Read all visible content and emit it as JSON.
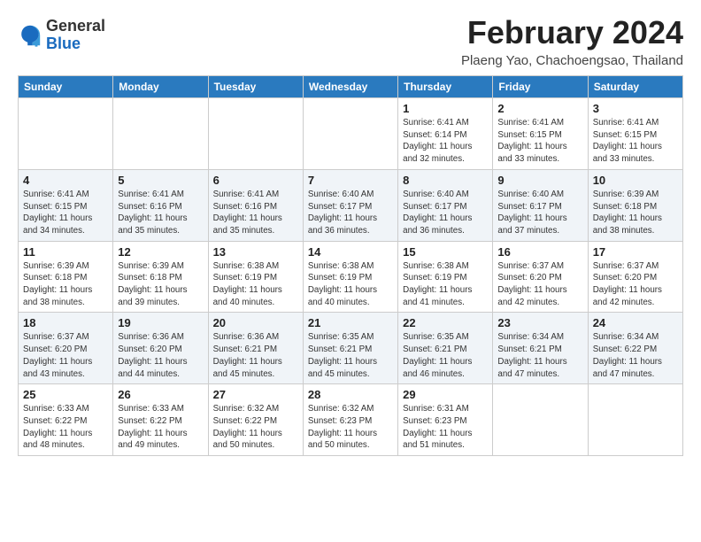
{
  "header": {
    "logo_general": "General",
    "logo_blue": "Blue",
    "month_title": "February 2024",
    "subtitle": "Plaeng Yao, Chachoengsao, Thailand"
  },
  "days_of_week": [
    "Sunday",
    "Monday",
    "Tuesday",
    "Wednesday",
    "Thursday",
    "Friday",
    "Saturday"
  ],
  "weeks": [
    [
      {
        "day": "",
        "info": ""
      },
      {
        "day": "",
        "info": ""
      },
      {
        "day": "",
        "info": ""
      },
      {
        "day": "",
        "info": ""
      },
      {
        "day": "1",
        "info": "Sunrise: 6:41 AM\nSunset: 6:14 PM\nDaylight: 11 hours\nand 32 minutes."
      },
      {
        "day": "2",
        "info": "Sunrise: 6:41 AM\nSunset: 6:15 PM\nDaylight: 11 hours\nand 33 minutes."
      },
      {
        "day": "3",
        "info": "Sunrise: 6:41 AM\nSunset: 6:15 PM\nDaylight: 11 hours\nand 33 minutes."
      }
    ],
    [
      {
        "day": "4",
        "info": "Sunrise: 6:41 AM\nSunset: 6:15 PM\nDaylight: 11 hours\nand 34 minutes."
      },
      {
        "day": "5",
        "info": "Sunrise: 6:41 AM\nSunset: 6:16 PM\nDaylight: 11 hours\nand 35 minutes."
      },
      {
        "day": "6",
        "info": "Sunrise: 6:41 AM\nSunset: 6:16 PM\nDaylight: 11 hours\nand 35 minutes."
      },
      {
        "day": "7",
        "info": "Sunrise: 6:40 AM\nSunset: 6:17 PM\nDaylight: 11 hours\nand 36 minutes."
      },
      {
        "day": "8",
        "info": "Sunrise: 6:40 AM\nSunset: 6:17 PM\nDaylight: 11 hours\nand 36 minutes."
      },
      {
        "day": "9",
        "info": "Sunrise: 6:40 AM\nSunset: 6:17 PM\nDaylight: 11 hours\nand 37 minutes."
      },
      {
        "day": "10",
        "info": "Sunrise: 6:39 AM\nSunset: 6:18 PM\nDaylight: 11 hours\nand 38 minutes."
      }
    ],
    [
      {
        "day": "11",
        "info": "Sunrise: 6:39 AM\nSunset: 6:18 PM\nDaylight: 11 hours\nand 38 minutes."
      },
      {
        "day": "12",
        "info": "Sunrise: 6:39 AM\nSunset: 6:18 PM\nDaylight: 11 hours\nand 39 minutes."
      },
      {
        "day": "13",
        "info": "Sunrise: 6:38 AM\nSunset: 6:19 PM\nDaylight: 11 hours\nand 40 minutes."
      },
      {
        "day": "14",
        "info": "Sunrise: 6:38 AM\nSunset: 6:19 PM\nDaylight: 11 hours\nand 40 minutes."
      },
      {
        "day": "15",
        "info": "Sunrise: 6:38 AM\nSunset: 6:19 PM\nDaylight: 11 hours\nand 41 minutes."
      },
      {
        "day": "16",
        "info": "Sunrise: 6:37 AM\nSunset: 6:20 PM\nDaylight: 11 hours\nand 42 minutes."
      },
      {
        "day": "17",
        "info": "Sunrise: 6:37 AM\nSunset: 6:20 PM\nDaylight: 11 hours\nand 42 minutes."
      }
    ],
    [
      {
        "day": "18",
        "info": "Sunrise: 6:37 AM\nSunset: 6:20 PM\nDaylight: 11 hours\nand 43 minutes."
      },
      {
        "day": "19",
        "info": "Sunrise: 6:36 AM\nSunset: 6:20 PM\nDaylight: 11 hours\nand 44 minutes."
      },
      {
        "day": "20",
        "info": "Sunrise: 6:36 AM\nSunset: 6:21 PM\nDaylight: 11 hours\nand 45 minutes."
      },
      {
        "day": "21",
        "info": "Sunrise: 6:35 AM\nSunset: 6:21 PM\nDaylight: 11 hours\nand 45 minutes."
      },
      {
        "day": "22",
        "info": "Sunrise: 6:35 AM\nSunset: 6:21 PM\nDaylight: 11 hours\nand 46 minutes."
      },
      {
        "day": "23",
        "info": "Sunrise: 6:34 AM\nSunset: 6:21 PM\nDaylight: 11 hours\nand 47 minutes."
      },
      {
        "day": "24",
        "info": "Sunrise: 6:34 AM\nSunset: 6:22 PM\nDaylight: 11 hours\nand 47 minutes."
      }
    ],
    [
      {
        "day": "25",
        "info": "Sunrise: 6:33 AM\nSunset: 6:22 PM\nDaylight: 11 hours\nand 48 minutes."
      },
      {
        "day": "26",
        "info": "Sunrise: 6:33 AM\nSunset: 6:22 PM\nDaylight: 11 hours\nand 49 minutes."
      },
      {
        "day": "27",
        "info": "Sunrise: 6:32 AM\nSunset: 6:22 PM\nDaylight: 11 hours\nand 50 minutes."
      },
      {
        "day": "28",
        "info": "Sunrise: 6:32 AM\nSunset: 6:23 PM\nDaylight: 11 hours\nand 50 minutes."
      },
      {
        "day": "29",
        "info": "Sunrise: 6:31 AM\nSunset: 6:23 PM\nDaylight: 11 hours\nand 51 minutes."
      },
      {
        "day": "",
        "info": ""
      },
      {
        "day": "",
        "info": ""
      }
    ]
  ]
}
